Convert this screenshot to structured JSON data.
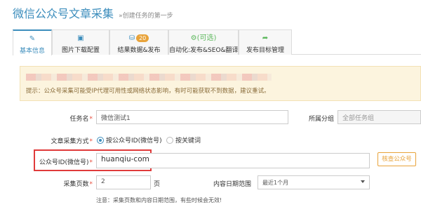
{
  "page": {
    "title": "微信公众号文章采集",
    "subtitle": "»创建任务的第一步"
  },
  "tabs": [
    {
      "label": "基本信息",
      "icon": "edit-icon",
      "active": true
    },
    {
      "label": "图片下载配置",
      "icon": "image-icon",
      "active": false
    },
    {
      "label": "结果数据&发布",
      "icon": "database-icon",
      "badge": "20",
      "active": false
    },
    {
      "label": "自动化:发布&SEO&翻译",
      "icon": "gears-icon",
      "icon_text": "(可选)",
      "active": false
    },
    {
      "label": "发布目标管理",
      "icon": "share-icon",
      "active": false
    }
  ],
  "alert": {
    "tip": "提示：公众号采集可能受IP代理可用性或网络状态影响，有时可能获取不到数据，建议重试。"
  },
  "form": {
    "task_name_label": "任务名",
    "task_name_value": "微信测试1",
    "group_label": "所属分组",
    "group_value": "全部任务组",
    "mode_label": "文章采集方式",
    "mode_option1": "按公众号ID(微信号)",
    "mode_option2": "按关键词",
    "account_label": "公众号ID(微信号)",
    "account_value": "huanqiu-com",
    "check_button": "核查公众号",
    "pages_label": "采集页数",
    "pages_value": "2",
    "pages_unit": "页",
    "date_label": "内容日期范围",
    "date_value": "最近1个月",
    "note": "注意：采集页数和内容日期范围，有些时候会无效!"
  },
  "colors": {
    "accent": "#3c8dbc",
    "warning": "#e8a33a",
    "highlight_box": "#e03b3b",
    "required": "#e74c3c"
  }
}
